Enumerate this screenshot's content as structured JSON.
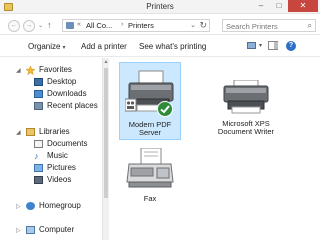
{
  "window": {
    "title": "Printers",
    "icon": "folder-icon",
    "controls": {
      "minimize": "–",
      "maximize": "□",
      "close": "✕"
    }
  },
  "nav": {
    "back": "←",
    "forward": "→",
    "recent": "⌄",
    "up": "↑"
  },
  "address": {
    "breadcrumbs": [
      "All Co...",
      "Printers"
    ],
    "separator": "›",
    "overflow": "«"
  },
  "search": {
    "placeholder": "Search Printers",
    "icon": "search-icon"
  },
  "commands": {
    "organize": "Organize",
    "add_printer": "Add a printer",
    "see_printing": "See what's printing"
  },
  "sidebar": {
    "favorites_label": "Favorites",
    "favorites": [
      "Desktop",
      "Downloads",
      "Recent places"
    ],
    "libraries_label": "Libraries",
    "libraries": [
      "Documents",
      "Music",
      "Pictures",
      "Videos"
    ],
    "homegroup_label": "Homegroup",
    "computer_label": "Computer"
  },
  "devices": [
    {
      "name_lines": [
        "Modern PDF",
        "Server"
      ],
      "selected": true,
      "default": true,
      "icon": "printer-icon"
    },
    {
      "name_lines": [
        "Microsoft XPS",
        "Document Writer"
      ],
      "selected": false,
      "default": false,
      "icon": "printer-icon"
    },
    {
      "name_lines": [
        "Fax"
      ],
      "selected": false,
      "default": false,
      "icon": "fax-icon"
    }
  ],
  "colors": {
    "selection_fill": "#cce8ff",
    "selection_border": "#99d1ff",
    "default_check": "#2e8b3a",
    "close_button": "#c7463e"
  }
}
